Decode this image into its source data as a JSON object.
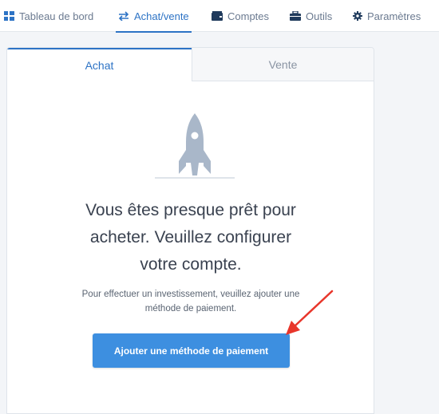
{
  "nav": {
    "items": [
      {
        "label": "Tableau de bord",
        "icon": "dashboard-icon"
      },
      {
        "label": "Achat/vente",
        "icon": "swap-icon",
        "active": true
      },
      {
        "label": "Comptes",
        "icon": "wallet-icon"
      },
      {
        "label": "Outils",
        "icon": "briefcase-icon"
      },
      {
        "label": "Paramètres",
        "icon": "gear-icon"
      }
    ]
  },
  "tabs": [
    {
      "label": "Achat",
      "active": true
    },
    {
      "label": "Vente",
      "active": false
    }
  ],
  "empty_state": {
    "icon": "rocket-icon",
    "headline_line1": "Vous êtes presque prêt pour",
    "headline_line2": "acheter. Veuillez configurer",
    "headline_line3": "votre compte.",
    "subtext_line1": "Pour effectuer un investissement, veuillez ajouter une",
    "subtext_line2": "méthode de paiement.",
    "button_label": "Ajouter une méthode de paiement"
  },
  "colors": {
    "accent": "#2d73c5",
    "button": "#3d8fe0",
    "annotation_arrow": "#e8362b",
    "rocket": "#a9b7c9"
  }
}
